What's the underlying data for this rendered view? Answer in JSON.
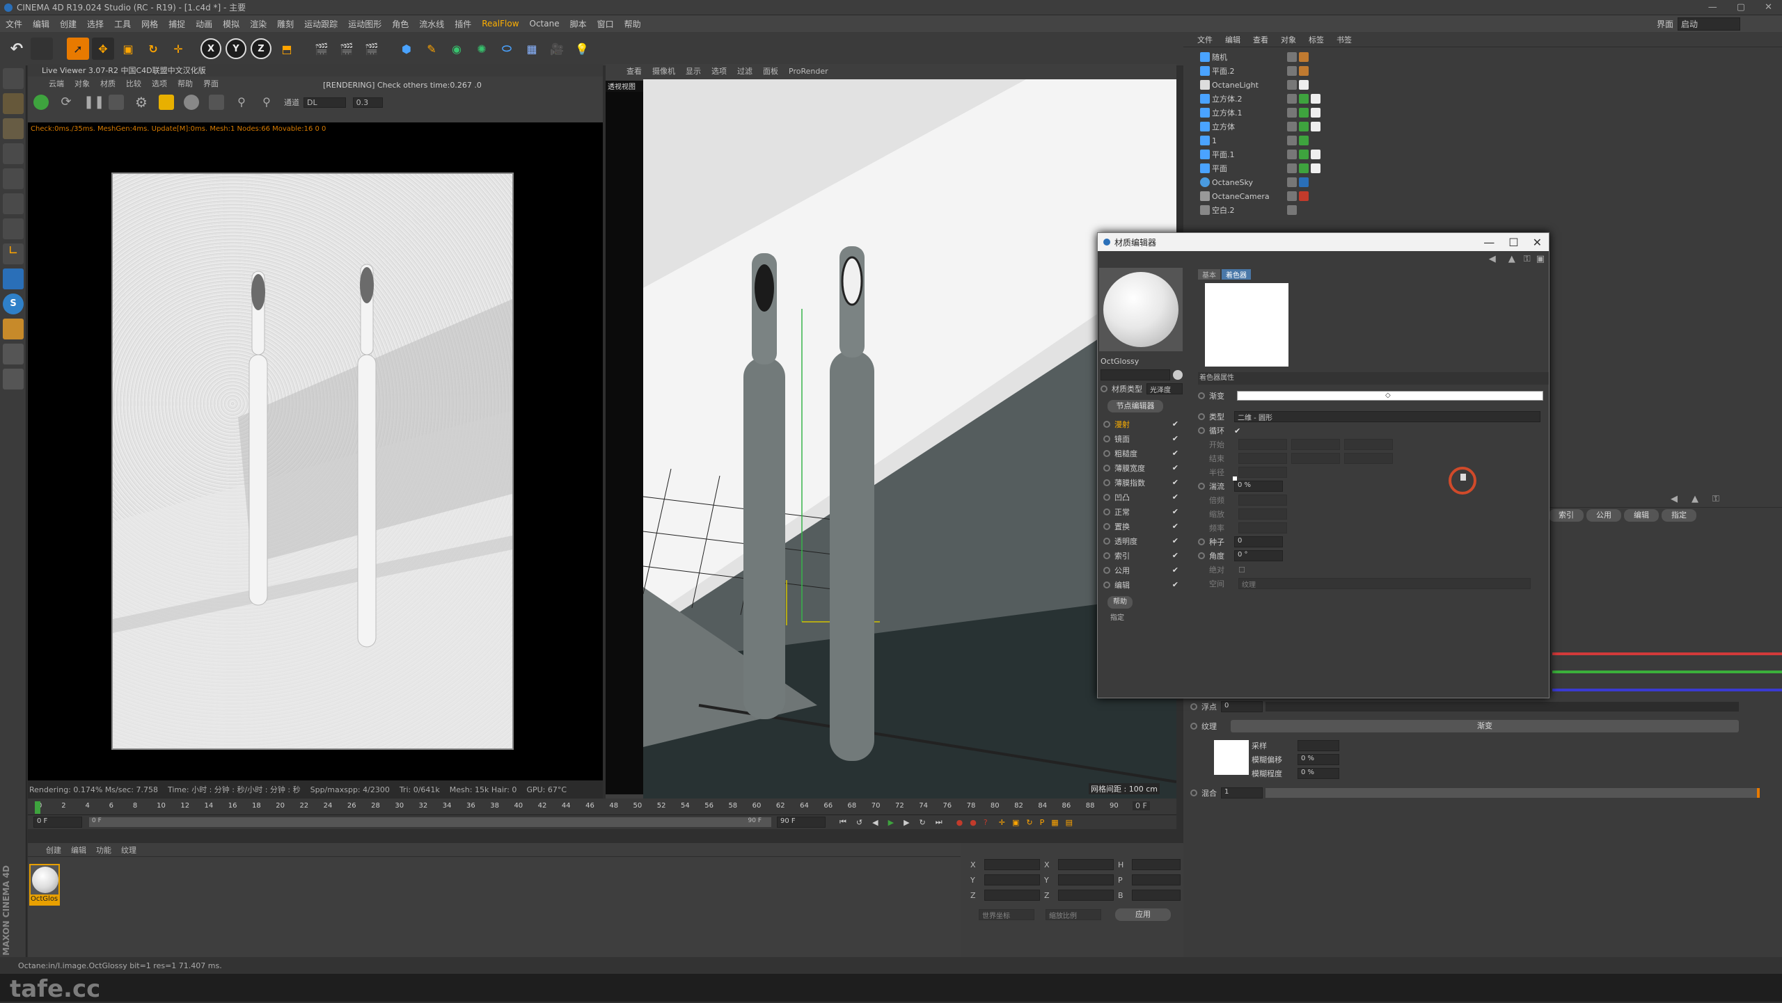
{
  "app": {
    "title": "CINEMA 4D R19.024 Studio (RC - R19) - [1.c4d *] - 主要",
    "layout_label": "界面",
    "layout_value": "启动"
  },
  "menu": [
    "文件",
    "编辑",
    "创建",
    "选择",
    "工具",
    "网格",
    "捕捉",
    "动画",
    "模拟",
    "渲染",
    "雕刻",
    "运动跟踪",
    "运动图形",
    "角色",
    "流水线",
    "插件",
    "RealFlow",
    "Octane",
    "脚本",
    "窗口",
    "帮助"
  ],
  "colors": {
    "accent": "#ffb000",
    "highlight": "#e87a00",
    "red_circle": "#d04a2a"
  },
  "live_viewer": {
    "title": "Live Viewer 3.07-R2 中国C4D联盟中文汉化版",
    "menu": [
      "云端",
      "对象",
      "材质",
      "比较",
      "选项",
      "帮助",
      "界面"
    ],
    "status": "[RENDERING] Check others time:0.267 .0",
    "channel_label": "通道",
    "channel_value": "DL",
    "channel_num": "0.3",
    "check_line": "Check:0ms./35ms. MeshGen:4ms. Update[M]:0ms. Mesh:1 Nodes:66 Movable:16 0 0",
    "footer": [
      "Rendering: 0.174%  Ms/sec: 7.758",
      "Time: 小时 : 分钟 : 秒/小时 : 分钟 : 秒",
      "Spp/maxspp: 4/2300",
      "Tri: 0/641k",
      "Mesh: 15k  Hair: 0",
      "GPU: 67°C"
    ]
  },
  "viewport": {
    "menu": [
      "查看",
      "摄像机",
      "显示",
      "选项",
      "过滤",
      "面板",
      "ProRender"
    ],
    "view_name": "透视视图",
    "grid_label": "网格间距 : 100 cm"
  },
  "object_manager": {
    "menu": [
      "文件",
      "编辑",
      "查看",
      "对象",
      "标签",
      "书签"
    ],
    "items": [
      {
        "name": "随机"
      },
      {
        "name": "平面.2"
      },
      {
        "name": "OctaneLight"
      },
      {
        "name": "立方体.2"
      },
      {
        "name": "立方体.1"
      },
      {
        "name": "立方体"
      },
      {
        "name": "1"
      },
      {
        "name": "平面.1"
      },
      {
        "name": "平面"
      },
      {
        "name": "OctaneSky"
      },
      {
        "name": "OctaneCamera"
      },
      {
        "name": "空白.2"
      }
    ]
  },
  "material_editor": {
    "title": "材质编辑器",
    "tabs": [
      "基本",
      "着色器"
    ],
    "material_name": "OctGlossy",
    "material_type_label": "材质类型",
    "material_type_value": "光泽度",
    "node_editor_btn": "节点编辑器",
    "channels": [
      {
        "label": "漫射",
        "active": true
      },
      {
        "label": "镜面"
      },
      {
        "label": "粗糙度"
      },
      {
        "label": "薄膜宽度"
      },
      {
        "label": "薄膜指数"
      },
      {
        "label": "凹凸"
      },
      {
        "label": "正常"
      },
      {
        "label": "置换"
      },
      {
        "label": "透明度"
      },
      {
        "label": "索引"
      },
      {
        "label": "公用"
      },
      {
        "label": "编辑"
      }
    ],
    "bottom_btns": [
      "帮助",
      "指定"
    ],
    "section": "着色器属性",
    "gradient_label": "渐变",
    "type_label": "类型",
    "type_value": "二维 - 圆形",
    "loop_label": "循环",
    "start_label": "开始",
    "end_label": "结束",
    "radius_label": "半径",
    "turb_label": "湍流",
    "turb_value": "0 %",
    "octave_label": "倍频",
    "scale_label": "缩放",
    "freq_label": "频率",
    "seed_label": "种子",
    "seed_value": "0",
    "angle_label": "角度",
    "angle_value": "0 °",
    "abs_label": "绝对",
    "space_label": "空间",
    "space_value": "纹理"
  },
  "attr_manager": {
    "tabs": [
      "索引",
      "公用",
      "编辑",
      "指定"
    ],
    "float_label": "浮点",
    "float_value": "0",
    "texture_label": "纹理",
    "texture_value": "渐变",
    "sampling_label": "采样",
    "blur_offset_label": "模糊偏移",
    "blur_offset_value": "0 %",
    "blur_degree_label": "模糊程度",
    "blur_degree_value": "0 %",
    "mix_label": "混合",
    "mix_value": "1"
  },
  "timeline": {
    "ticks": [
      "0",
      "2",
      "4",
      "6",
      "8",
      "10",
      "12",
      "14",
      "16",
      "18",
      "20",
      "22",
      "24",
      "26",
      "28",
      "30",
      "32",
      "34",
      "36",
      "38",
      "40",
      "42",
      "44",
      "46",
      "48",
      "50",
      "52",
      "54",
      "56",
      "58",
      "60",
      "62",
      "64",
      "66",
      "68",
      "70",
      "72",
      "74",
      "76",
      "78",
      "80",
      "82",
      "84",
      "86",
      "88",
      "90"
    ],
    "frame_end_label": "0 F",
    "start": "0 F",
    "range_start": "0 F",
    "range_end": "90 F",
    "end": "90 F"
  },
  "material_manager": {
    "menu": [
      "创建",
      "编辑",
      "功能",
      "纹理"
    ],
    "material": "OctGlos"
  },
  "coords": {
    "apply": "应用",
    "world": "世界坐标",
    "scale": "缩放比例"
  },
  "status_bar": "Octane:in/I.image.OctGlossy  bit=1 res=1  71.407 ms.",
  "watermark": "tafe.cc"
}
